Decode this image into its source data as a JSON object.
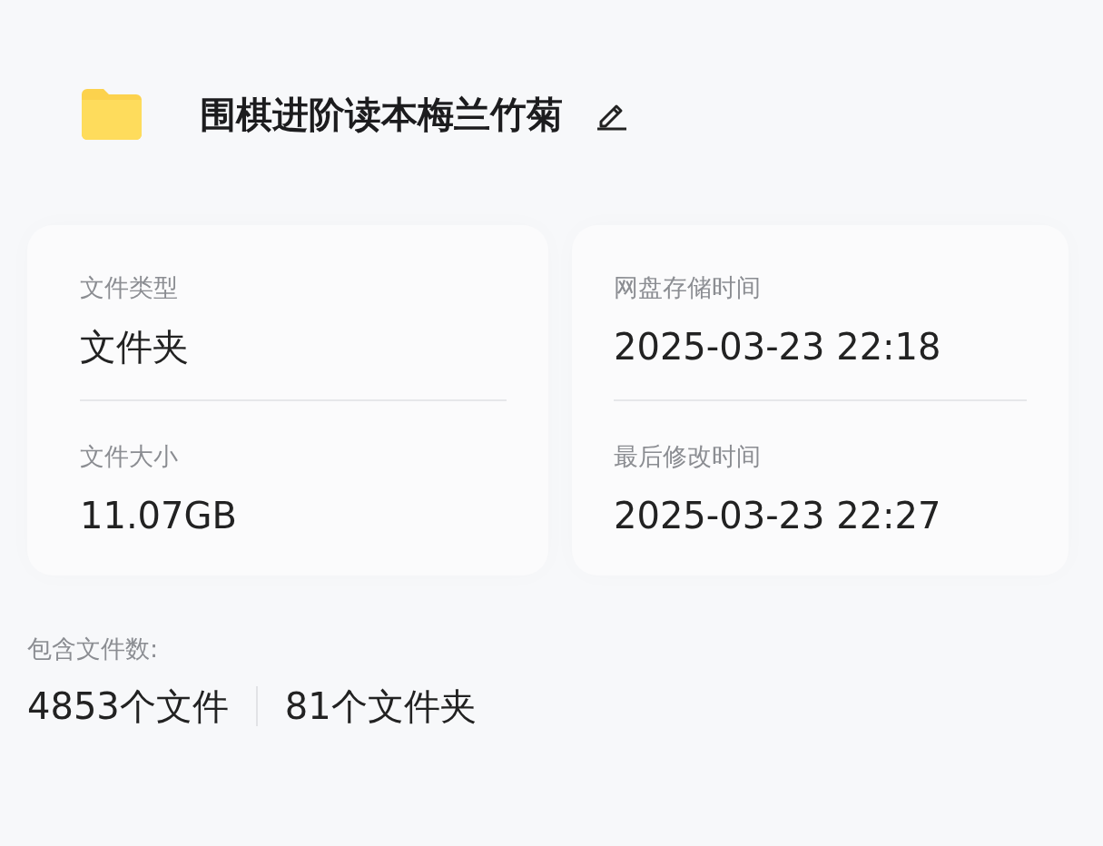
{
  "header": {
    "title": "围棋进阶读本梅兰竹菊"
  },
  "cards": [
    {
      "fields": [
        {
          "label": "文件类型",
          "value": "文件夹"
        },
        {
          "label": "文件大小",
          "value": "11.07GB"
        }
      ]
    },
    {
      "fields": [
        {
          "label": "网盘存储时间",
          "value": "2025-03-23 22:18"
        },
        {
          "label": "最后修改时间",
          "value": "2025-03-23 22:27"
        }
      ]
    }
  ],
  "contents": {
    "label": "包含文件数:",
    "counts": [
      "4853个文件",
      "81个文件夹"
    ]
  }
}
